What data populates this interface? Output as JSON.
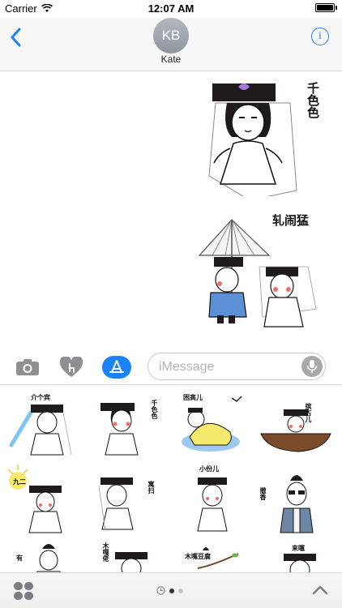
{
  "status_bar": {
    "carrier": "Carrier",
    "time": "12:07 AM"
  },
  "header": {
    "avatar_initials": "KB",
    "contact_name": "Kate",
    "info_label": "i"
  },
  "conversation": {
    "stickers": [
      {
        "caption": "千色色"
      },
      {
        "caption": "轧闹猛"
      }
    ]
  },
  "input_bar": {
    "placeholder": "iMessage"
  },
  "drawer": {
    "stickers": [
      {
        "caption": "介个宾"
      },
      {
        "caption": "千色色"
      },
      {
        "caption": "困高儿"
      },
      {
        "caption": "摈古儿"
      },
      {
        "caption": "九二"
      },
      {
        "caption": "寓扫"
      },
      {
        "caption": "小份儿"
      },
      {
        "caption": "撤香"
      },
      {
        "caption": "有"
      },
      {
        "caption": "木嘎佬"
      },
      {
        "caption": "木嘴豆腐"
      },
      {
        "caption": ""
      },
      {
        "caption": "来噻"
      }
    ]
  },
  "page_indicator": {
    "pages": 3,
    "current": 1
  },
  "colors": {
    "accent": "#1a82fb",
    "hat": "#1f1a1c",
    "blush": "#f26a6a",
    "robe_blue": "#5b8fd6",
    "lotus": "#a67bd6"
  }
}
